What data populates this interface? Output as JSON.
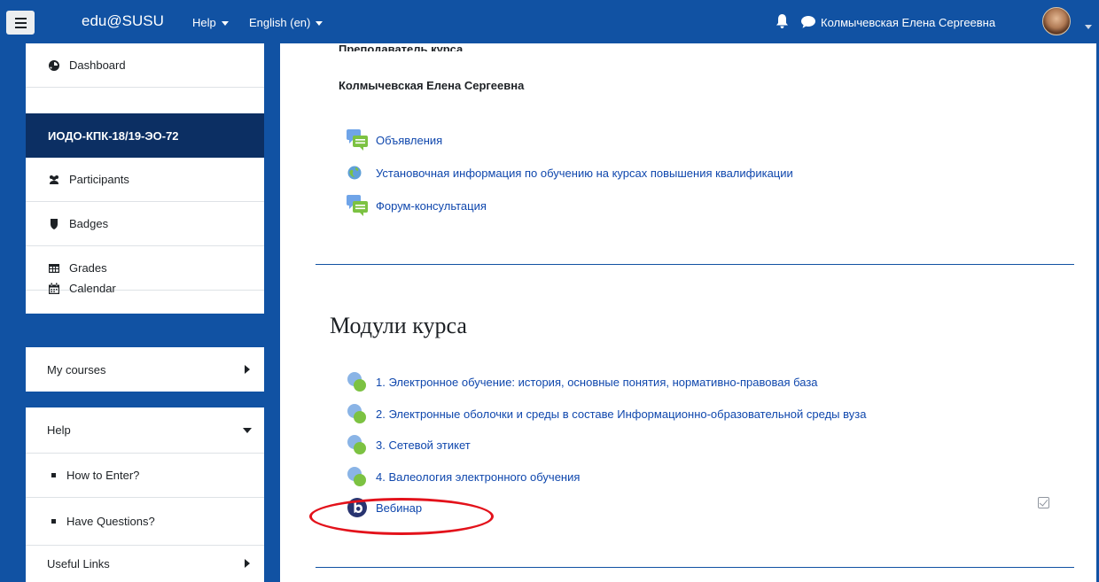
{
  "navbar": {
    "brand": "edu@SUSU",
    "help_menu": "Help",
    "language_menu": "English (en)",
    "user_name": "Колмычевская Елена Сергеевна",
    "colors": {
      "navbar": "#1152a3",
      "active_item": "#0c2f63",
      "link": "#0f47ad",
      "highlight": "#e3121b"
    }
  },
  "sidebar": {
    "dashboard": "Dashboard",
    "course": "ИОДО-КПК-18/19-ЭО-72",
    "participants": "Participants",
    "badges": "Badges",
    "grades": "Grades",
    "calendar": "Calendar",
    "my_courses": "My courses",
    "help": "Help",
    "how_to_enter": "How to Enter?",
    "have_questions": "Have Questions?",
    "useful_links": "Useful Links"
  },
  "main": {
    "teacher_label": "Преподаватель курса",
    "teacher_name": "Колмычевская Елена Сергеевна",
    "resources": [
      {
        "label": "Объявления",
        "icon": "forum-icon"
      },
      {
        "label": "Установочная информация по обучению на курсах повышения квалификации",
        "icon": "url-icon"
      },
      {
        "label": "Форум-консультация",
        "icon": "forum-icon"
      }
    ],
    "section_title": "Модули курса",
    "modules": [
      {
        "label": "1. Электронное обучение: история, основные понятия, нормативно-правовая база",
        "icon": "lesson-icon"
      },
      {
        "label": "2. Электронные оболочки и среды в составе Информационно-образовательной среды вуза",
        "icon": "lesson-icon"
      },
      {
        "label": "3. Сетевой этикет",
        "icon": "lesson-icon"
      },
      {
        "label": "4. Валеология электронного обучения",
        "icon": "lesson-icon"
      }
    ],
    "webinar": {
      "label": "Вебинар",
      "icon": "bigbluebutton-icon",
      "completion": "checkbox-icon"
    }
  }
}
